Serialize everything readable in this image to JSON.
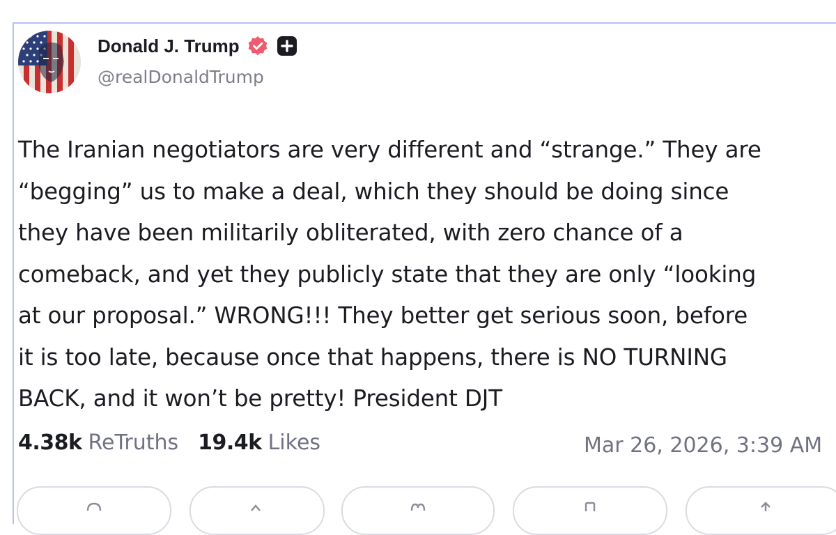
{
  "post": {
    "author": {
      "display_name": "Donald J. Trump",
      "handle": "@realDonaldTrump",
      "verified_icon": "verified-badge-icon",
      "plus_icon": "plus-badge-icon"
    },
    "body_lines": [
      "The Iranian negotiators are very different and “strange.” They are",
      "“begging” us to make a deal, which they should be doing since",
      "they have been militarily obliterated, with zero chance of a",
      "comeback, and yet they publicly state that they are only “looking",
      "at our proposal.” WRONG!!! They better get serious soon, before",
      "it is too late, because once that happens, there is NO TURNING",
      "BACK, and it won’t be pretty! President DJT"
    ],
    "stats": {
      "retruths_count": "4.38k",
      "retruths_label": "ReTruths",
      "likes_count": "19.4k",
      "likes_label": "Likes"
    },
    "timestamp": "Mar 26, 2026, 3:39 AM"
  },
  "actions": [
    {
      "icon": "reply-icon"
    },
    {
      "icon": "retruth-icon"
    },
    {
      "icon": "like-icon"
    },
    {
      "icon": "bookmark-icon"
    },
    {
      "icon": "share-icon"
    }
  ],
  "colors": {
    "border_accent": "#b4c0f2",
    "verified_badge": "#ef5b6e",
    "muted_text": "#707283",
    "primary_text": "#1b1c22"
  }
}
